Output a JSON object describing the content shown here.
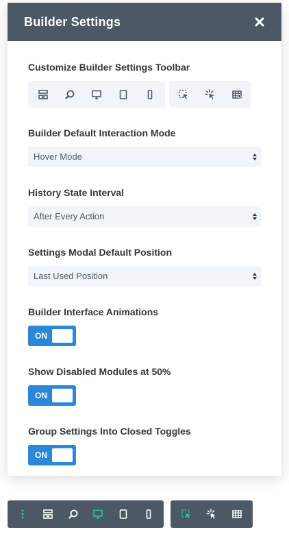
{
  "modal": {
    "title": "Builder Settings",
    "close_icon": "close-icon"
  },
  "toolbar_setting": {
    "label": "Customize Builder Settings Toolbar",
    "group_a": [
      "layout-icon",
      "zoom-icon",
      "desktop-icon",
      "tablet-icon",
      "phone-icon"
    ],
    "group_b": [
      "click-mode-icon",
      "hover-mode-icon",
      "grid-icon"
    ]
  },
  "interaction_mode": {
    "label": "Builder Default Interaction Mode",
    "value": "Hover Mode"
  },
  "history_interval": {
    "label": "History State Interval",
    "value": "After Every Action"
  },
  "modal_position": {
    "label": "Settings Modal Default Position",
    "value": "Last Used Position"
  },
  "animations": {
    "label": "Builder Interface Animations",
    "state": "ON"
  },
  "disabled_modules": {
    "label": "Show Disabled Modules at 50%",
    "state": "ON"
  },
  "group_settings": {
    "label": "Group Settings Into Closed Toggles",
    "state": "ON"
  },
  "bottom_toolbar": {
    "group_a": [
      "drag-handle-icon",
      "layout-icon",
      "zoom-icon",
      "desktop-icon",
      "tablet-icon",
      "phone-icon"
    ],
    "group_b": [
      "click-mode-icon",
      "hover-mode-icon",
      "grid-icon"
    ],
    "active_color": "#29c4a9"
  },
  "colors": {
    "header": "#4c5866",
    "toggle": "#2b87da",
    "field_bg": "#f1f5f9"
  }
}
